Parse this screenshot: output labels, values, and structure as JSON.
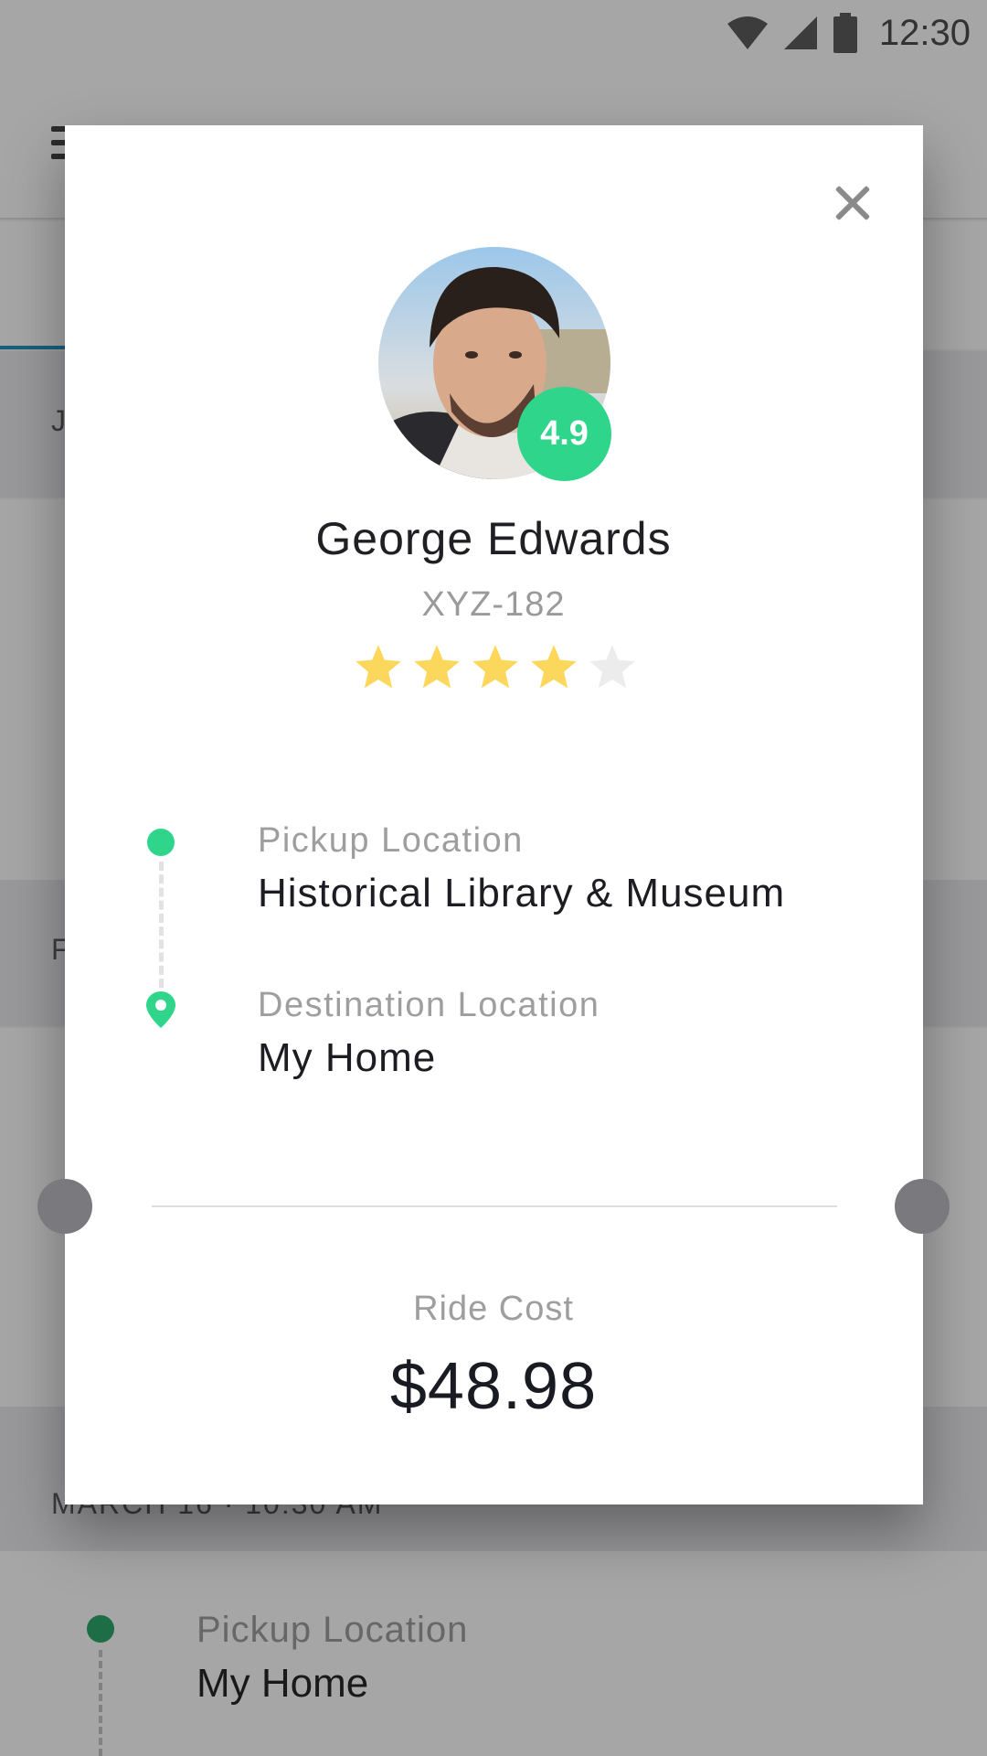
{
  "status_bar": {
    "time": "12:30"
  },
  "background": {
    "section_1_label": "J",
    "section_2_label": "F",
    "section_3_label": "MARCH 16 · 10:30 AM",
    "trip": {
      "pickup_label": "Pickup Location",
      "pickup_value": "My Home"
    }
  },
  "modal": {
    "driver": {
      "name": "George Edwards",
      "plate": "XYZ-182",
      "rating": "4.9",
      "stars_filled": 4,
      "stars_total": 5
    },
    "route": {
      "pickup_label": "Pickup Location",
      "pickup_value": "Historical Library & Museum",
      "destination_label": "Destination Location",
      "destination_value": "My Home"
    },
    "cost": {
      "label": "Ride Cost",
      "value": "$48.98"
    }
  },
  "colors": {
    "accent_green": "#2fd58a",
    "star_filled": "#fbd75b",
    "star_empty": "#ececec",
    "text_dark": "#1c1c22",
    "text_muted": "#9e9e9e"
  },
  "icons": {
    "close": "close-icon",
    "pickup": "pickup-dot-icon",
    "destination": "location-pin-icon",
    "star": "star-icon"
  }
}
